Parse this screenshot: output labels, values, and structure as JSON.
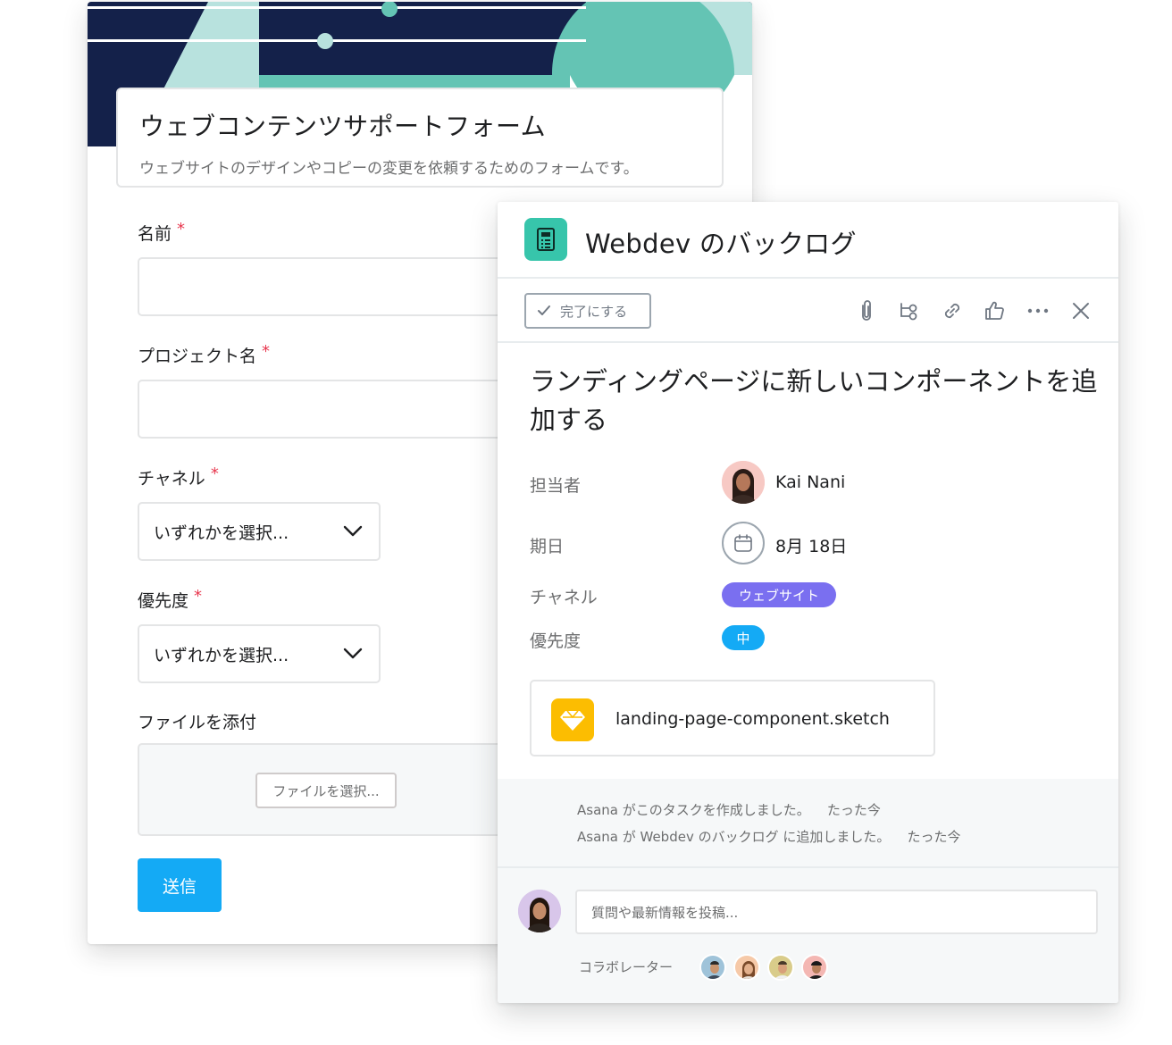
{
  "form": {
    "title": "ウェブコンテンツサポートフォーム",
    "description": "ウェブサイトのデザインやコピーの変更を依頼するためのフォームです。",
    "required_mark": "*",
    "fields": {
      "name": {
        "label": "名前"
      },
      "project": {
        "label": "プロジェクト名"
      },
      "channel": {
        "label": "チャネル",
        "value": "いずれかを選択..."
      },
      "priority": {
        "label": "優先度",
        "value": "いずれかを選択..."
      },
      "file": {
        "label": "ファイルを添付",
        "button": "ファイルを選択..."
      }
    },
    "submit_label": "送信",
    "banner_colors": {
      "navy": "#14214a",
      "teal": "#64c4b4",
      "light_teal": "#b8e2de"
    }
  },
  "task": {
    "project_title": "Webdev のバックログ",
    "complete_label": "完了にする",
    "toolbar_icons": [
      "paperclip-icon",
      "subtask-icon",
      "link-icon",
      "thumbs-up-icon",
      "more-icon",
      "close-icon"
    ],
    "title": "ランディングページに新しいコンポーネントを追加する",
    "assignee": {
      "label": "担当者",
      "name": "Kai Nani"
    },
    "due": {
      "label": "期日",
      "value": "8月 18日"
    },
    "channel": {
      "label": "チャネル",
      "value": "ウェブサイト",
      "color": "#7a6ff0"
    },
    "priority": {
      "label": "優先度",
      "value": "中",
      "color": "#14aaf5"
    },
    "attachment": {
      "filename": "landing-page-component.sketch"
    },
    "activity": [
      {
        "text": "Asana がこのタスクを作成しました。",
        "time": "たった今"
      },
      {
        "text": "Asana が Webdev のバックログ に追加しました。",
        "time": "たった今"
      }
    ],
    "comment_placeholder": "質問や最新情報を投稿...",
    "collaborators_label": "コラボレーター",
    "collaborator_count": 4
  }
}
